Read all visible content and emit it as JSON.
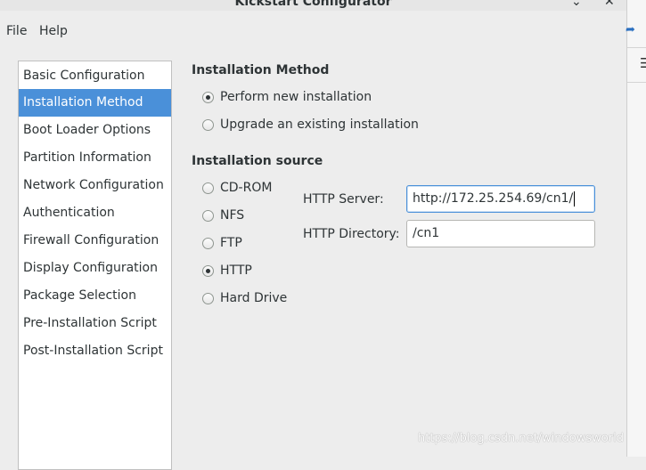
{
  "window": {
    "title": "Kickstart Configurator",
    "minimize_glyph": "⌄",
    "close_glyph": "✕"
  },
  "menubar": {
    "file": "File",
    "help": "Help"
  },
  "sidebar": {
    "items": [
      {
        "label": "Basic Configuration",
        "selected": false
      },
      {
        "label": "Installation Method",
        "selected": true
      },
      {
        "label": "Boot Loader Options",
        "selected": false
      },
      {
        "label": "Partition Information",
        "selected": false
      },
      {
        "label": "Network Configuration",
        "selected": false
      },
      {
        "label": "Authentication",
        "selected": false
      },
      {
        "label": "Firewall Configuration",
        "selected": false
      },
      {
        "label": "Display Configuration",
        "selected": false
      },
      {
        "label": "Package Selection",
        "selected": false
      },
      {
        "label": "Pre-Installation Script",
        "selected": false
      },
      {
        "label": "Post-Installation Script",
        "selected": false
      }
    ]
  },
  "installation_method": {
    "title": "Installation Method",
    "options": [
      {
        "label": "Perform new installation",
        "checked": true
      },
      {
        "label": "Upgrade an existing installation",
        "checked": false
      }
    ]
  },
  "installation_source": {
    "title": "Installation source",
    "options": [
      {
        "label": "CD-ROM",
        "checked": false
      },
      {
        "label": "NFS",
        "checked": false
      },
      {
        "label": "FTP",
        "checked": false
      },
      {
        "label": "HTTP",
        "checked": true
      },
      {
        "label": "Hard Drive",
        "checked": false
      }
    ],
    "http_server_label": "HTTP Server:",
    "http_server_value": "http://172.25.254.69/cn1/",
    "http_directory_label": "HTTP Directory:",
    "http_directory_value": "/cn1"
  },
  "watermark": "https://blog.csdn.net/windowsworld",
  "colors": {
    "selection": "#4a90d9",
    "window_bg": "#ededed"
  }
}
